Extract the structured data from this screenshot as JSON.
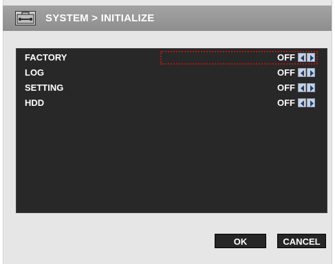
{
  "header": {
    "title": "SYSTEM > INITIALIZE",
    "icon": "toolbox-icon"
  },
  "settings": {
    "items": [
      {
        "label": "FACTORY",
        "value": "OFF"
      },
      {
        "label": "LOG",
        "value": "OFF"
      },
      {
        "label": "SETTING",
        "value": "OFF"
      },
      {
        "label": "HDD",
        "value": "OFF"
      }
    ]
  },
  "footer": {
    "ok_label": "OK",
    "cancel_label": "CANCEL"
  },
  "colors": {
    "title_bar": "#999999",
    "panel_bg": "#282828",
    "focus_outline": "#b01818",
    "arrow_button": "#c9d1dd"
  }
}
